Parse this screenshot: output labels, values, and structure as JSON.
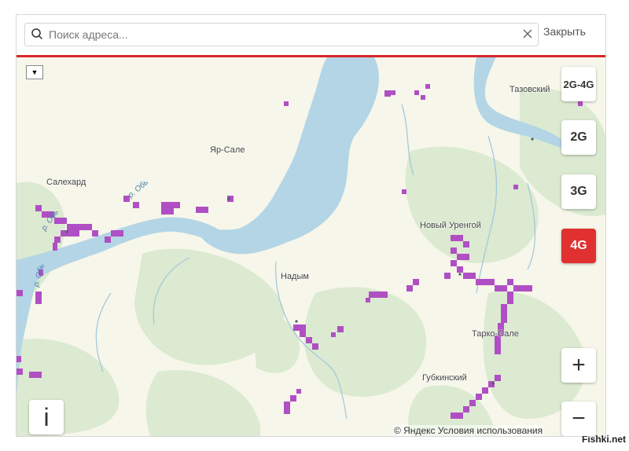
{
  "search": {
    "placeholder": "Поиск адреса...",
    "value": ""
  },
  "close_label": "Закрыть",
  "layer_dropdown_symbol": "▼",
  "network_buttons": [
    {
      "label": "2G-4G",
      "active": false
    },
    {
      "label": "2G",
      "active": false
    },
    {
      "label": "3G",
      "active": false
    },
    {
      "label": "4G",
      "active": true
    }
  ],
  "zoom": {
    "in": "+",
    "out": "−"
  },
  "info_label": "i",
  "attribution": {
    "copyright": "© Яндекс",
    "terms": "Условия использования"
  },
  "map_labels": {
    "yar_sale": "Яр-Сале",
    "salekhard": "Салехард",
    "tazovsky": "Тазовский",
    "novy_urengoy": "Новый Уренгой",
    "nadym": "Надым",
    "tarko_sale": "Тарко-Сале",
    "gubkinsky": "Губкинский"
  },
  "river_labels": {
    "ob_1": "р. Обь",
    "ob_2": "р. Обь",
    "ob_3": "р. Обь"
  },
  "colors": {
    "accent": "#e03130",
    "coverage": "#b04fc4",
    "water": "#b3d5e6",
    "land": "#f6f6ea",
    "forest": "#dbead0"
  },
  "watermark": "Fishki.net"
}
